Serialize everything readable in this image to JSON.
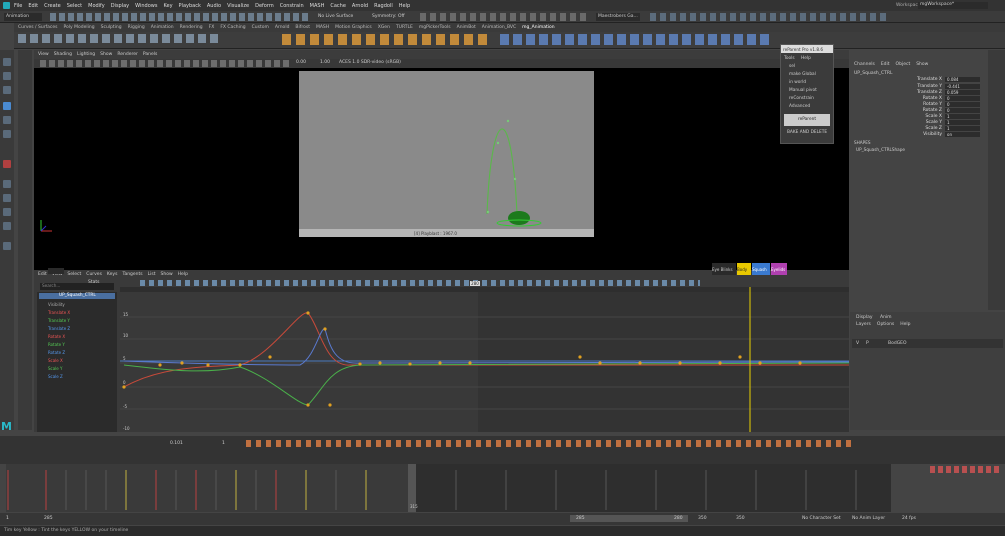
{
  "menu": [
    "File",
    "Edit",
    "Create",
    "Select",
    "Modify",
    "Display",
    "Windows",
    "Key",
    "Playback",
    "Audio",
    "Visualize",
    "Deform",
    "Constrain",
    "MASH",
    "Cache",
    "Arnold",
    "Ragdoll",
    "Help"
  ],
  "workspace": {
    "label": "Workspace:",
    "value": "mgWorkspace*"
  },
  "status": {
    "mode": "Animation",
    "live_surface": "No Live Surface",
    "symmetry": "Symmetry: Off",
    "controller": "Maestrobers Ga..."
  },
  "shelf_tabs": [
    "Curves / Surfaces",
    "Poly Modeling",
    "Sculpting",
    "Rigging",
    "Animation",
    "Rendering",
    "FX",
    "FX Caching",
    "Custom",
    "Arnold",
    "Bifrost",
    "MASH",
    "Motion Graphics",
    "XGen",
    "TURTLE",
    "mgPickerTools",
    "AnimBot",
    "Animation_BVC",
    "mg_Animation"
  ],
  "viewport": {
    "menus": [
      "View",
      "Shading",
      "Lighting",
      "Show",
      "Renderer",
      "Panels"
    ],
    "colorspace": "ACES 1.0 SDR-video (sRGB)",
    "cam_field1": "0.00",
    "cam_field2": "1.00",
    "hud": "[4] Playblast : 1967.0"
  },
  "picker": {
    "title": "reParent Pro v1.8.6",
    "menus": [
      "Tools",
      "Help"
    ],
    "items": [
      "sel",
      "make Global",
      "in world",
      "Manual pivot",
      "reConstrain",
      "Advanced"
    ],
    "button": "reParent",
    "bake": "BAKE AND DELETE"
  },
  "channel": {
    "menus": [
      "Channels",
      "Edit",
      "Object",
      "Show"
    ],
    "object": "UP_Squash_CTRL",
    "rows": [
      {
        "n": "Translate X",
        "v": "0.084"
      },
      {
        "n": "Translate Y",
        "v": "-0.441"
      },
      {
        "n": "Translate Z",
        "v": "0.059"
      },
      {
        "n": "Rotate X",
        "v": "0"
      },
      {
        "n": "Rotate Y",
        "v": "0"
      },
      {
        "n": "Rotate Z",
        "v": "0"
      },
      {
        "n": "Scale X",
        "v": "1"
      },
      {
        "n": "Scale Y",
        "v": "1"
      },
      {
        "n": "Scale Z",
        "v": "1"
      },
      {
        "n": "Visibility",
        "v": "on"
      }
    ],
    "shapes": "SHAPES",
    "shape_name": "UP_Squash_CTRLShape"
  },
  "layers": {
    "tabs": [
      "Display",
      "Anim"
    ],
    "menus": [
      "Layers",
      "Options",
      "Help"
    ],
    "row": {
      "v": "V",
      "p": "P",
      "name": "BodGEO"
    }
  },
  "graph": {
    "menus": [
      "Edit",
      "View",
      "Select",
      "Curves",
      "Keys",
      "Tangents",
      "List",
      "Show",
      "Help"
    ],
    "stats": "Stats",
    "val1": "0.101",
    "val2": "1",
    "search": "Search...",
    "node": "UP_Squash_CTRL",
    "channels": [
      "Visibility",
      "Translate X",
      "Translate Y",
      "Translate Z",
      "Rotate X",
      "Rotate Y",
      "Rotate Z",
      "Scale X",
      "Scale Y",
      "Scale Z"
    ],
    "yticks": [
      "15",
      "10",
      "5",
      "0",
      "-5",
      "-10"
    ],
    "frame_tag": "280",
    "pickers": [
      "Eye Blinks",
      "Body",
      "Squash",
      "Eyelids"
    ]
  },
  "timebar": {
    "val1": "0.101",
    "val2": "1"
  },
  "range": {
    "start": "1",
    "start2": "285",
    "current": "315",
    "end1": "285",
    "end2": "280",
    "end3": "350",
    "end4": "350",
    "character": "No Character Set",
    "anim_layer": "No Anim Layer",
    "fps": "24 fps"
  },
  "help": "Tim key Yellow : Tint the keys YELLOW on your timeline"
}
